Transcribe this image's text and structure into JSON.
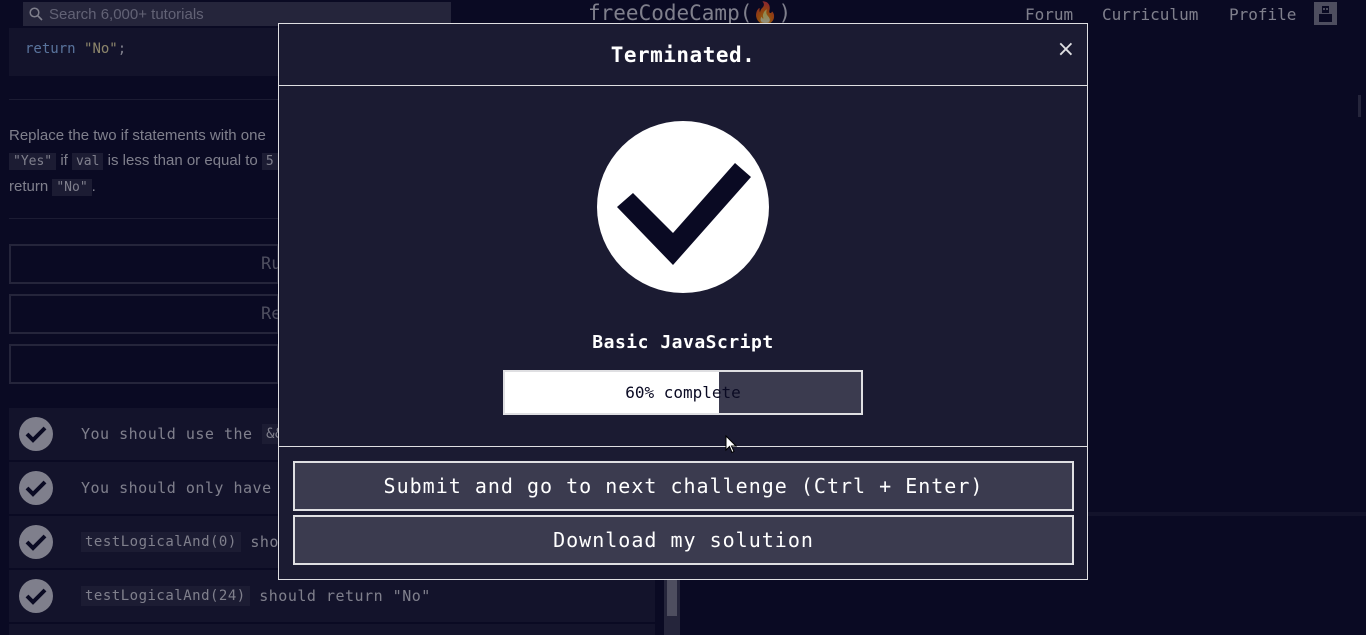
{
  "nav": {
    "search_placeholder": "Search 6,000+ tutorials",
    "logo": "freeCodeCamp(🔥)",
    "links": [
      "Forum",
      "Curriculum",
      "Profile"
    ]
  },
  "background": {
    "code_line": "return \"No\";",
    "code_keyword": "return",
    "code_string": "\"No\"",
    "description": {
      "line1": "Replace the two if statements with one",
      "line2_code1": "\"Yes\"",
      "line2_text1": "if",
      "line2_code2": "val",
      "line2_text2": "is less than or equal to",
      "line2_code3": "5",
      "line3_text": "return",
      "line3_code": "\"No\"",
      "line3_end": "."
    },
    "buttons": [
      "Ru",
      "Re",
      ""
    ],
    "tests": [
      {
        "pre": "You should use the",
        "code": "&&",
        "post": ""
      },
      {
        "pre": "You should only have",
        "code": "",
        "post": ""
      },
      {
        "pre": "",
        "code": "testLogicalAnd(0)",
        "post": "shou"
      },
      {
        "pre": "",
        "code": "testLogicalAnd(24)",
        "post": "should return \"No\""
      }
    ]
  },
  "modal": {
    "title": "Terminated.",
    "close_label": "×",
    "block_name": "Basic JavaScript",
    "progress_text": "60% complete",
    "progress_percent": 60,
    "submit_label": "Submit and go to next challenge (Ctrl + Enter)",
    "download_label": "Download my solution"
  }
}
